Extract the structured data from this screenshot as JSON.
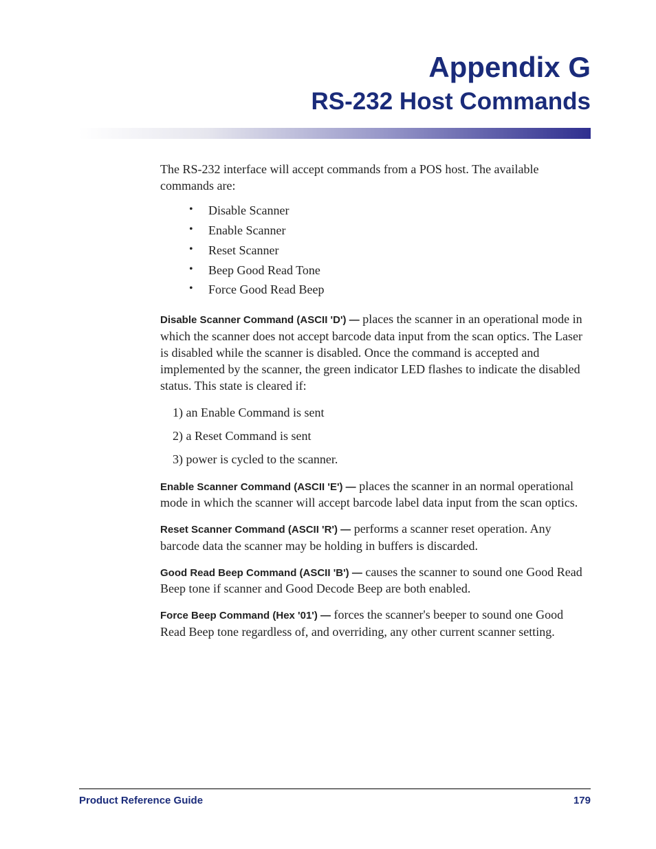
{
  "title": {
    "line1": "Appendix G",
    "line2": "RS-232 Host Commands"
  },
  "intro": "The RS-232 interface will accept commands from a POS host. The available commands are:",
  "bullets": [
    "Disable Scanner",
    "Enable Scanner",
    "Reset Scanner",
    "Beep Good Read Tone",
    "Force Good Read Beep"
  ],
  "sections": {
    "disable": {
      "lead": "Disable Scanner Command (ASCII 'D') —",
      "text": " places the scanner in an operational mode in which the scanner does not accept barcode data input from the scan optics. The Laser is disabled while the scanner is disabled. Once the command is accepted and implemented by the scanner, the green indicator LED flashes to indicate the disabled status. This state is cleared if:"
    },
    "clear_list": [
      "1) an Enable Command is sent",
      "2) a Reset Command is sent",
      "3) power is cycled to the scanner."
    ],
    "enable": {
      "lead": "Enable Scanner Command (ASCII 'E') —",
      "text": " places the scanner in an normal operational mode in which the scanner will accept barcode label data input from the scan optics."
    },
    "reset": {
      "lead": "Reset Scanner Command (ASCII 'R') —",
      "text": " performs a scanner reset operation. Any barcode data the scanner may be holding in buffers is discarded."
    },
    "goodread": {
      "lead": "Good Read Beep Command (ASCII 'B') —",
      "text": " causes the scanner to sound one Good Read Beep tone if scanner and Good Decode Beep are both enabled."
    },
    "forcebeep": {
      "lead": "Force Beep Command (Hex '01') —",
      "text": " forces the scanner's beeper to sound one Good Read Beep tone regardless of, and overriding, any other current scanner setting."
    }
  },
  "footer": {
    "left": "Product Reference Guide",
    "right": "179"
  }
}
